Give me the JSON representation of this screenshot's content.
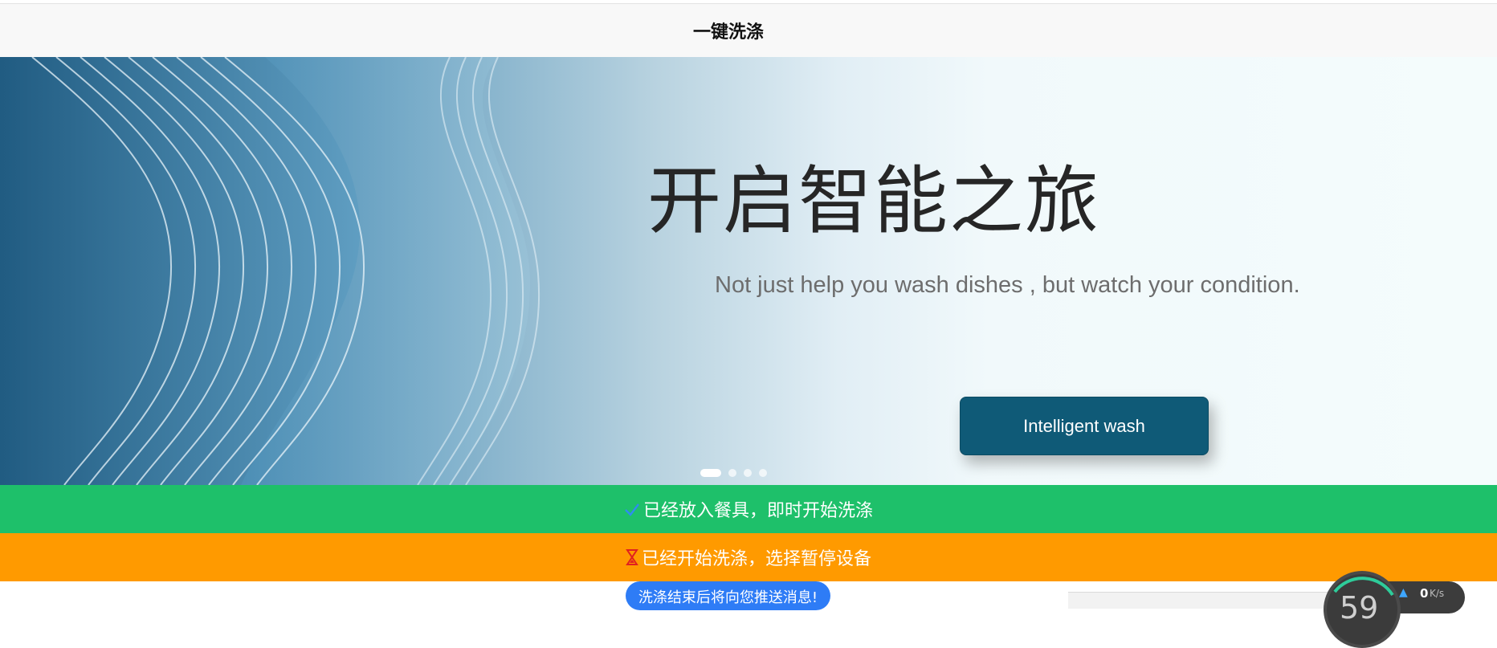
{
  "header": {
    "title": "一键洗涤"
  },
  "banner": {
    "headline": "开启智能之旅",
    "subline": "Not just help you wash dishes , but watch your condition.",
    "cta_label": "Intelligent wash",
    "slide_count": 4,
    "active_slide": 1
  },
  "actions": {
    "start_label": "已经放入餐具，即时开始洗涤",
    "pause_label": "已经开始洗涤，选择暂停设备"
  },
  "notice": {
    "text": "洗涤结束后将向您推送消息!"
  },
  "system_widget": {
    "value": "59",
    "speed_value": "0",
    "speed_unit": "K/s"
  },
  "colors": {
    "start_bar": "#1ec06a",
    "pause_bar": "#ff9a00",
    "cta_bg": "#0f5a77",
    "notice_bg": "#2e7cf6"
  }
}
